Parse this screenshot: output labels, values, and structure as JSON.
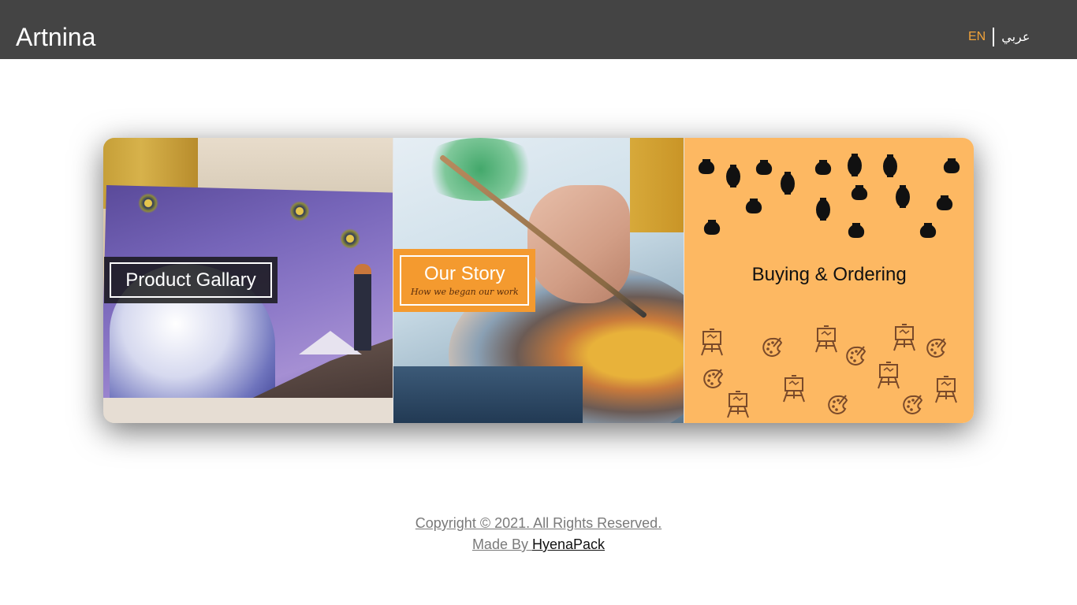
{
  "header": {
    "brand": "Artnina",
    "lang_en": "EN",
    "lang_ar": "عربي"
  },
  "cards": [
    {
      "label": "Product Gallary"
    },
    {
      "title": "Our Story",
      "subtitle": "How we began our work"
    },
    {
      "title": "Buying & Ordering"
    }
  ],
  "footer": {
    "copyright": "Copyright © 2021. All Rights Reserved.",
    "made_by": "Made By ",
    "author": "HyenaPack"
  },
  "colors": {
    "header_bg": "#444444",
    "accent_orange": "#f49a2f",
    "card3_bg": "#fdb862",
    "lang_active": "#f1a33a"
  },
  "icons": [
    "vase-icon",
    "easel-icon",
    "palette-icon"
  ]
}
